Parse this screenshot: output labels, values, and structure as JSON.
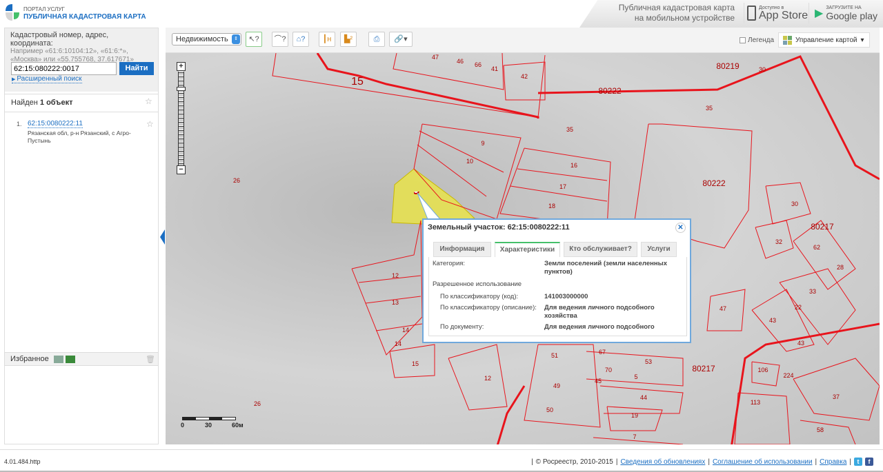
{
  "header": {
    "portal": "ПОРТАЛ УСЛУГ",
    "title": "ПУБЛИЧНАЯ КАДАСТРОВАЯ КАРТА",
    "promo_line1": "Публичная кадастровая карта",
    "promo_line2": "на мобильном устройстве",
    "appstore_small": "Доступно в",
    "appstore_big": "App Store",
    "gplay_small": "ЗАГРУЗИТЕ НА",
    "gplay_big": "Google play"
  },
  "search": {
    "label": "Кадастровый номер, адрес, координата:",
    "hint": "Например «61:6:10104:12», «61:6:*», «Москва» или «55.755768, 37.617671»",
    "value": "62:15:080222:0017",
    "button": "Найти",
    "advanced": "Расширенный поиск"
  },
  "results": {
    "found_prefix": "Найден",
    "found_count": "1 объект",
    "items": [
      {
        "num": "1.",
        "id": "62:15:0080222:11",
        "address": "Рязанская обл, р-н Рязанский, с Агро-Пустынь"
      }
    ]
  },
  "favorites": {
    "label": "Избранное"
  },
  "toolbar": {
    "select": "Недвижимость",
    "legend": "Легенда",
    "map_control": "Управление картой"
  },
  "map": {
    "scale": [
      "0",
      "30",
      "60м"
    ],
    "labels": [
      "47",
      "46",
      "66",
      "41",
      "42",
      "15",
      "80219",
      "30",
      "80222",
      "35",
      "35",
      "9",
      "10",
      "16",
      "17",
      "18",
      "26",
      "80222",
      "30",
      "80217",
      "32",
      "62",
      "28",
      "12",
      "13",
      "14",
      "14",
      "15",
      "47",
      "33",
      "22",
      "43",
      "43",
      "51",
      "53",
      "70",
      "5",
      "80217",
      "106",
      "224",
      "12",
      "49",
      "44",
      "113",
      "37",
      "50",
      "19",
      "58",
      "7",
      "26",
      "67",
      "45"
    ]
  },
  "popup": {
    "title": "Земельный участок: 62:15:0080222:11",
    "tabs": [
      "Информация",
      "Характеристики",
      "Кто обслуживает?",
      "Услуги"
    ],
    "active_tab": "Характеристики",
    "category_label": "Категория:",
    "category_value": "Земли поселений (земли населенных пунктов)",
    "permitted_label": "Разрешенное использование",
    "rows": [
      {
        "label": "По классификатору (код):",
        "value": "141003000000"
      },
      {
        "label": "По классификатору (описание):",
        "value": "Для ведения личного подсобного хозяйства"
      },
      {
        "label": "По документу:",
        "value": "Для ведения личного подсобного"
      }
    ]
  },
  "footer": {
    "version": "4.01.484.http",
    "copyright": "© Росреестр, 2010-2015",
    "links": [
      "Сведения об обновлениях",
      "Соглашение об использовании",
      "Справка"
    ]
  },
  "colors": {
    "accent": "#1b6ec2",
    "parcel": "#e8141c",
    "selected_parcel": "#e9e34a",
    "active_tab": "#45c06a"
  }
}
